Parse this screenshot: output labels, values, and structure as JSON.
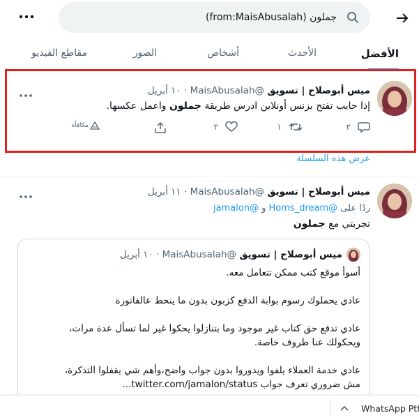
{
  "search": {
    "query": "جملون (from:MaisAbusalah)"
  },
  "tabs": [
    {
      "label": "الأفضل"
    },
    {
      "label": "الأحدث"
    },
    {
      "label": "أشخاص"
    },
    {
      "label": "الصور"
    },
    {
      "label": "مقاطع الفيديو"
    }
  ],
  "tweet1": {
    "name": "ميس أبوصلاح | تسويق",
    "handle": "@MaisAbusalah",
    "date": "١٠ أبريل",
    "text_before": "إذا حابب تفتح بزنس أونلاين ادرس طريقة ",
    "text_bold": "جملون",
    "text_after": " واعمل عكسها.",
    "reply_count": "٢",
    "retweet_count": "١",
    "like_count": "٢",
    "rewards_label": "مكافأة",
    "show_thread": "عرض هذه السلسلة"
  },
  "tweet2": {
    "name": "ميس أبوصلاح | تسويق",
    "handle": "@MaisAbusalah",
    "date": "١١ أبريل",
    "reply_prefix": "ردًا على",
    "reply_user1": "@Homs_dream",
    "reply_and": "و",
    "reply_user2": "@jamalon",
    "text_before": "تجربتي مع ",
    "text_bold": "جملون"
  },
  "quote": {
    "name": "ميس أبوصلاح | تسويق",
    "handle": "@MaisAbusalah",
    "date": "١٠ أبريل",
    "lines": [
      "أسوأ موقع كتب ممكن تتعامل معه.",
      "عادي يحملوك رسوم بوابة الدفع كزبون بدون ما ينحط عالفاتورة",
      "عادي تدفع حق كتاب غير موجود وما بتنازلوا يحكوا غير لما تسأل عدة مرات،",
      "ويحكولك عنا ظروف خاصة.",
      "عادي خدمة العملاء يلفوا ويدوروا بدون جواب واضح،وأهم شي يقفلوا التذكرة،",
      "مش ضروري تعرف جواب twitter.com/jamalon/status..."
    ]
  },
  "downloads": {
    "item_label": "WhatsApp Ptt"
  },
  "colors": {
    "accent": "#1d9bf0",
    "highlight": "#e0211f",
    "muted": "#536471"
  }
}
